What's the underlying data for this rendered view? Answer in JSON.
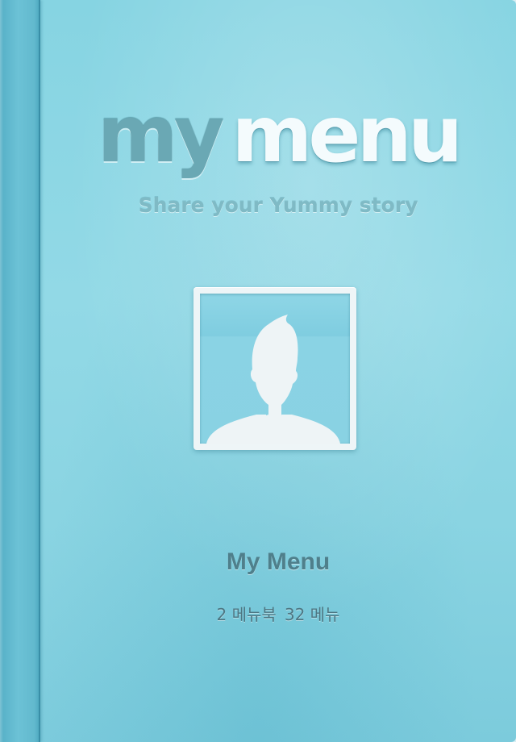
{
  "cover": {
    "logo_my": "my",
    "logo_menu": "menu",
    "tagline": "Share your Yummy story"
  },
  "profile": {
    "avatar_icon": "default-person-silhouette-icon",
    "name": "My Menu",
    "menubook_count": "2 메뉴북",
    "menu_count": "32 메뉴"
  },
  "colors": {
    "cover_background": "#8ad4e2",
    "spine": "#5fb6cc",
    "logo_my": "#6aa8b4",
    "logo_menu": "#f4fbfd",
    "name_text": "#4f7f8b"
  }
}
